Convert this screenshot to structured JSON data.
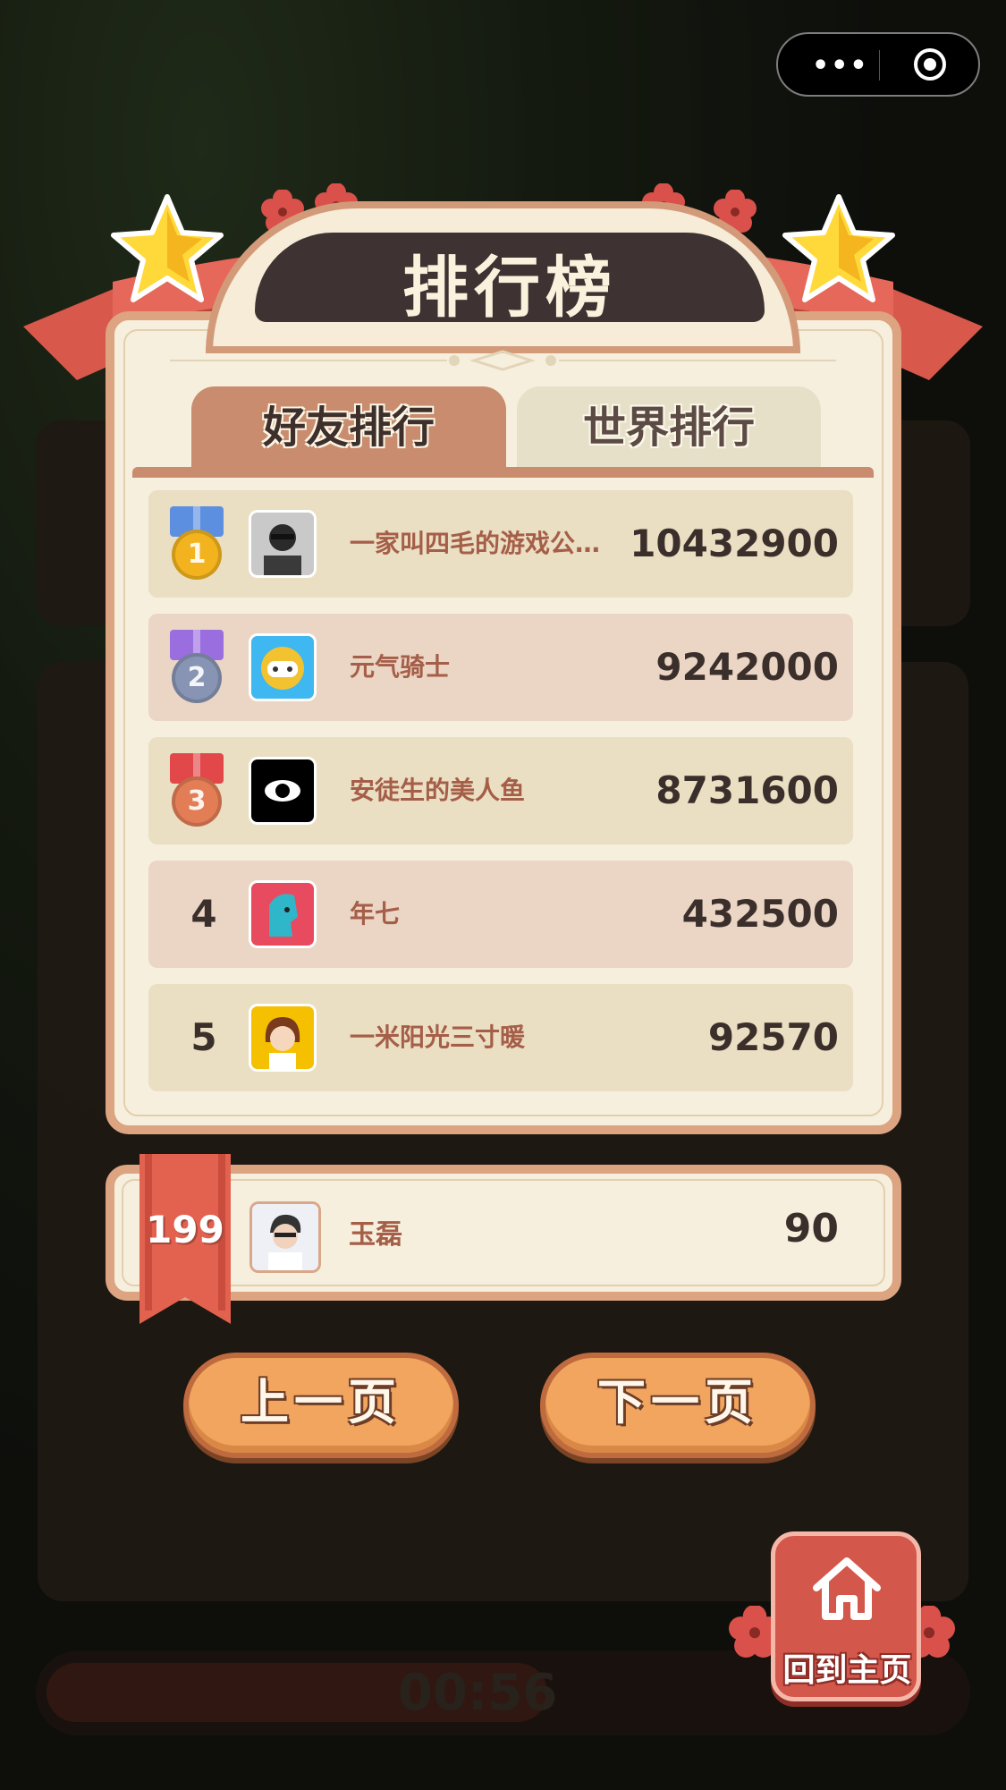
{
  "capsule": {
    "more_label": "•••"
  },
  "header": {
    "title": "排行榜"
  },
  "tabs": [
    {
      "label": "好友排行",
      "active": true
    },
    {
      "label": "世界排行",
      "active": false
    }
  ],
  "leaderboard": [
    {
      "rank": "1",
      "name": "一家叫四毛的游戏公…",
      "score": "10432900",
      "medal": "gold"
    },
    {
      "rank": "2",
      "name": "元气骑士",
      "score": "9242000",
      "medal": "silver"
    },
    {
      "rank": "3",
      "name": "安徒生的美人鱼",
      "score": "8731600",
      "medal": "bronze"
    },
    {
      "rank": "4",
      "name": "年七",
      "score": "432500",
      "medal": ""
    },
    {
      "rank": "5",
      "name": "一米阳光三寸暖",
      "score": "92570",
      "medal": ""
    }
  ],
  "me": {
    "rank": "199",
    "name": "玉磊",
    "score": "90"
  },
  "pagination": {
    "prev_label": "上一页",
    "next_label": "下一页"
  },
  "home": {
    "label": "回到主页"
  },
  "timer": {
    "text": "00:56"
  },
  "colors": {
    "medal_gold": "#f3b31e",
    "medal_silver": "#8894b4",
    "medal_bronze": "#e37d56",
    "strap_gold": "#5c8fe0",
    "strap_silver": "#9b6ee0",
    "strap_bronze": "#e2474a"
  }
}
